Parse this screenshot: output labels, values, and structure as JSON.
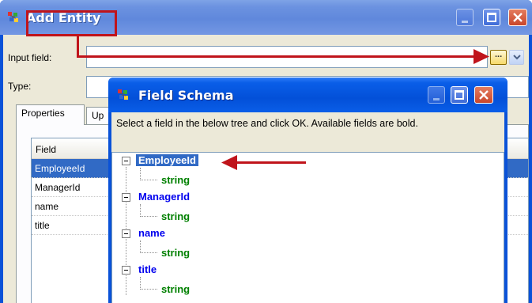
{
  "outer_window": {
    "title": "Add Entity",
    "input_label": "Input field:",
    "type_label": "Type:",
    "browse_button_label": "...",
    "dropdown_icon": "chevron-down-icon",
    "tabs": [
      {
        "label": "Properties",
        "active": true
      },
      {
        "label": "Up",
        "active": false
      }
    ],
    "grid": {
      "header": "Field",
      "rows": [
        "EmployeeId",
        "ManagerId",
        "name",
        "title"
      ],
      "selected_index": 0
    }
  },
  "inner_window": {
    "title": "Field Schema",
    "instruction": "Select a field in the below tree and click OK. Available fields are bold.",
    "tree": [
      {
        "label": "EmployeeId",
        "type": "string",
        "selected": true
      },
      {
        "label": "ManagerId",
        "type": "string",
        "selected": false
      },
      {
        "label": "name",
        "type": "string",
        "selected": false
      },
      {
        "label": "title",
        "type": "string",
        "selected": false
      }
    ]
  },
  "colors": {
    "annotation_red": "#c0141b",
    "xp_blue": "#0a52d8",
    "selection_blue": "#316ac5",
    "field_name_blue": "#0000ee",
    "type_green": "#008000"
  }
}
